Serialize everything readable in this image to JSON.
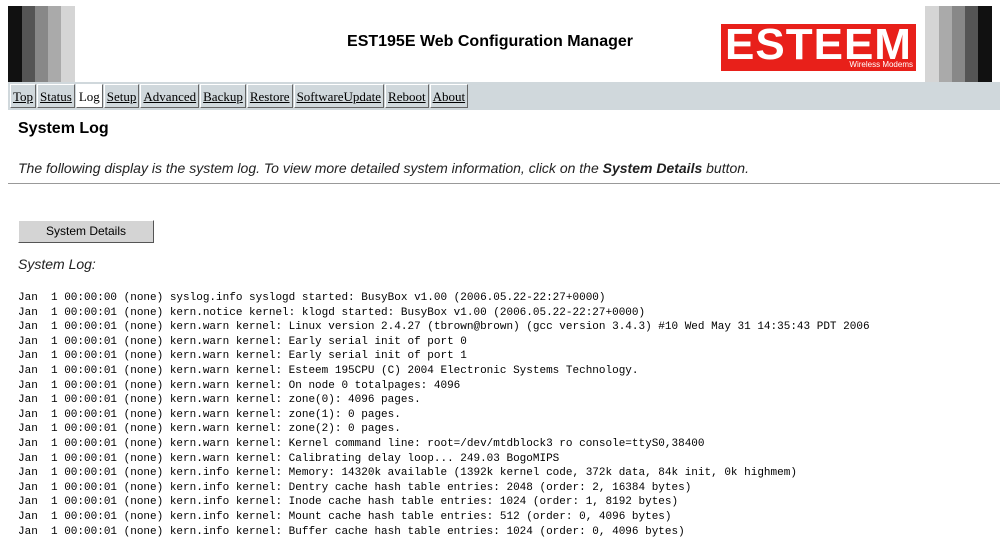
{
  "header": {
    "title": "EST195E Web Configuration Manager",
    "logo_text": "ESTEEM",
    "logo_sub": "Wireless Modems",
    "stripe_colors_left": [
      "#111111",
      "#555555",
      "#888888",
      "#aaaaaa",
      "#d5d5d5"
    ],
    "stripe_colors_right": [
      "#d5d5d5",
      "#aaaaaa",
      "#888888",
      "#555555",
      "#111111"
    ],
    "logo_color": "#e8201a"
  },
  "nav": {
    "tabs": [
      "Top",
      "Status",
      "Log",
      "Setup",
      "Advanced",
      "Backup",
      "Restore",
      "SoftwareUpdate",
      "Reboot",
      "About"
    ],
    "active": "Log"
  },
  "main": {
    "title": "System Log",
    "description_pre": "The following display is the system log. To view more detailed system information, click on the ",
    "description_bold": "System Details",
    "description_post": " button.",
    "button_label": "System Details",
    "log_label": "System Log:",
    "log_lines": [
      "Jan  1 00:00:00 (none) syslog.info syslogd started: BusyBox v1.00 (2006.05.22-22:27+0000)",
      "Jan  1 00:00:01 (none) kern.notice kernel: klogd started: BusyBox v1.00 (2006.05.22-22:27+0000)",
      "Jan  1 00:00:01 (none) kern.warn kernel: Linux version 2.4.27 (tbrown@brown) (gcc version 3.4.3) #10 Wed May 31 14:35:43 PDT 2006",
      "Jan  1 00:00:01 (none) kern.warn kernel: Early serial init of port 0",
      "Jan  1 00:00:01 (none) kern.warn kernel: Early serial init of port 1",
      "Jan  1 00:00:01 (none) kern.warn kernel: Esteem 195CPU (C) 2004 Electronic Systems Technology.",
      "Jan  1 00:00:01 (none) kern.warn kernel: On node 0 totalpages: 4096",
      "Jan  1 00:00:01 (none) kern.warn kernel: zone(0): 4096 pages.",
      "Jan  1 00:00:01 (none) kern.warn kernel: zone(1): 0 pages.",
      "Jan  1 00:00:01 (none) kern.warn kernel: zone(2): 0 pages.",
      "Jan  1 00:00:01 (none) kern.warn kernel: Kernel command line: root=/dev/mtdblock3 ro console=ttyS0,38400",
      "Jan  1 00:00:01 (none) kern.warn kernel: Calibrating delay loop... 249.03 BogoMIPS",
      "Jan  1 00:00:01 (none) kern.info kernel: Memory: 14320k available (1392k kernel code, 372k data, 84k init, 0k highmem)",
      "Jan  1 00:00:01 (none) kern.info kernel: Dentry cache hash table entries: 2048 (order: 2, 16384 bytes)",
      "Jan  1 00:00:01 (none) kern.info kernel: Inode cache hash table entries: 1024 (order: 1, 8192 bytes)",
      "Jan  1 00:00:01 (none) kern.info kernel: Mount cache hash table entries: 512 (order: 0, 4096 bytes)",
      "Jan  1 00:00:01 (none) kern.info kernel: Buffer cache hash table entries: 1024 (order: 0, 4096 bytes)"
    ]
  }
}
